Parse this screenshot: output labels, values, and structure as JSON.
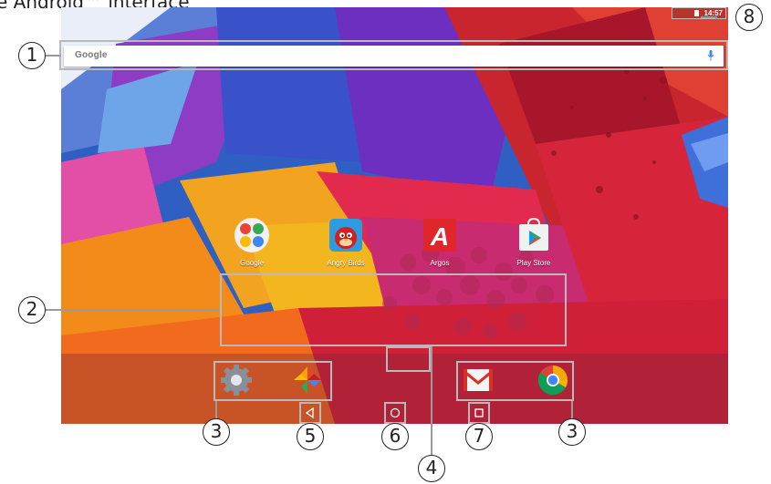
{
  "document": {
    "title": "e Android™ interface"
  },
  "status_bar": {
    "time": "14:57",
    "icons": [
      "battery-icon"
    ]
  },
  "search": {
    "logo": "Google",
    "icon": "mic-icon"
  },
  "apps": [
    {
      "label": "Google",
      "icon": "google-folder-icon"
    },
    {
      "label": "Angry Birds",
      "icon": "angry-birds-icon"
    },
    {
      "label": "Argos",
      "icon": "argos-icon"
    },
    {
      "label": "Play Store",
      "icon": "play-store-icon"
    }
  ],
  "dock": {
    "icons": [
      "settings-icon",
      "photos-icon",
      "gmail-icon",
      "chrome-icon"
    ]
  },
  "nav": {
    "icons": [
      "back-icon",
      "home-icon",
      "recents-icon"
    ]
  },
  "callouts": [
    "1",
    "2",
    "3",
    "3",
    "4",
    "5",
    "6",
    "7",
    "8"
  ],
  "colors": {
    "frame": "#b9b9b9",
    "google_blue": "#4285f4",
    "wall_red": "#d3263d",
    "wall_blue": "#2b66c8"
  }
}
